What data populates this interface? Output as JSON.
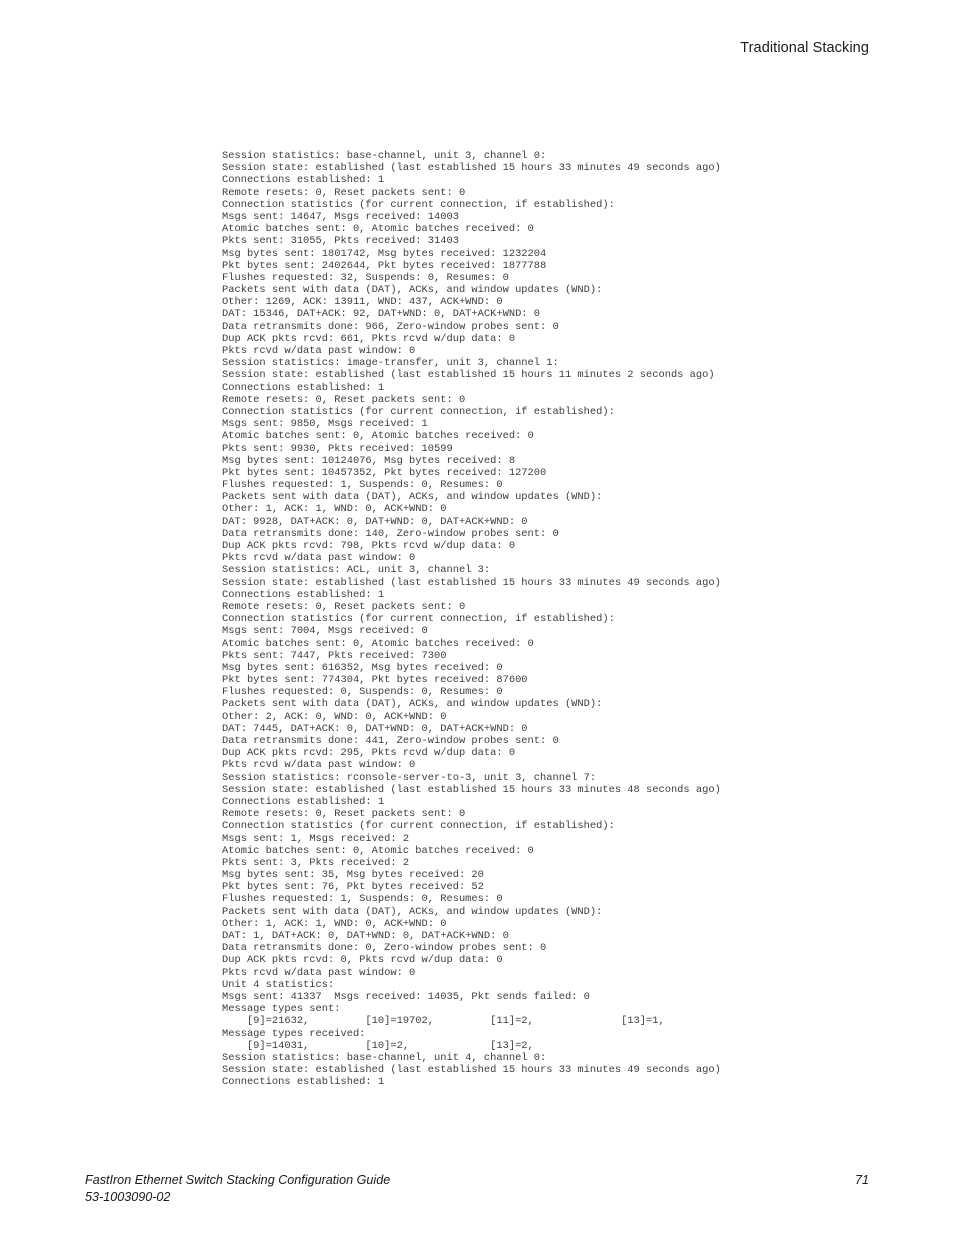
{
  "header": {
    "running_head": "Traditional Stacking"
  },
  "console_output": {
    "lines": [
      "Session statistics: base-channel, unit 3, channel 0:",
      "Session state: established (last established 15 hours 33 minutes 49 seconds ago)",
      "Connections established: 1",
      "Remote resets: 0, Reset packets sent: 0",
      "Connection statistics (for current connection, if established):",
      "Msgs sent: 14647, Msgs received: 14003",
      "Atomic batches sent: 0, Atomic batches received: 0",
      "Pkts sent: 31055, Pkts received: 31403",
      "Msg bytes sent: 1801742, Msg bytes received: 1232204",
      "Pkt bytes sent: 2402644, Pkt bytes received: 1877788",
      "Flushes requested: 32, Suspends: 0, Resumes: 0",
      "Packets sent with data (DAT), ACKs, and window updates (WND):",
      "Other: 1269, ACK: 13911, WND: 437, ACK+WND: 0",
      "DAT: 15346, DAT+ACK: 92, DAT+WND: 0, DAT+ACK+WND: 0",
      "Data retransmits done: 966, Zero-window probes sent: 0",
      "Dup ACK pkts rcvd: 661, Pkts rcvd w/dup data: 0",
      "Pkts rcvd w/data past window: 0",
      "Session statistics: image-transfer, unit 3, channel 1:",
      "Session state: established (last established 15 hours 11 minutes 2 seconds ago)",
      "Connections established: 1",
      "Remote resets: 0, Reset packets sent: 0",
      "Connection statistics (for current connection, if established):",
      "Msgs sent: 9850, Msgs received: 1",
      "Atomic batches sent: 0, Atomic batches received: 0",
      "Pkts sent: 9930, Pkts received: 10599",
      "Msg bytes sent: 10124076, Msg bytes received: 8",
      "Pkt bytes sent: 10457352, Pkt bytes received: 127200",
      "Flushes requested: 1, Suspends: 0, Resumes: 0",
      "Packets sent with data (DAT), ACKs, and window updates (WND):",
      "Other: 1, ACK: 1, WND: 0, ACK+WND: 0",
      "DAT: 9928, DAT+ACK: 0, DAT+WND: 0, DAT+ACK+WND: 0",
      "Data retransmits done: 140, Zero-window probes sent: 0",
      "Dup ACK pkts rcvd: 798, Pkts rcvd w/dup data: 0",
      "Pkts rcvd w/data past window: 0",
      "Session statistics: ACL, unit 3, channel 3:",
      "Session state: established (last established 15 hours 33 minutes 49 seconds ago)",
      "Connections established: 1",
      "Remote resets: 0, Reset packets sent: 0",
      "Connection statistics (for current connection, if established):",
      "Msgs sent: 7004, Msgs received: 0",
      "Atomic batches sent: 0, Atomic batches received: 0",
      "Pkts sent: 7447, Pkts received: 7300",
      "Msg bytes sent: 616352, Msg bytes received: 0",
      "Pkt bytes sent: 774304, Pkt bytes received: 87600",
      "Flushes requested: 0, Suspends: 0, Resumes: 0",
      "Packets sent with data (DAT), ACKs, and window updates (WND):",
      "Other: 2, ACK: 0, WND: 0, ACK+WND: 0",
      "DAT: 7445, DAT+ACK: 0, DAT+WND: 0, DAT+ACK+WND: 0",
      "Data retransmits done: 441, Zero-window probes sent: 0",
      "Dup ACK pkts rcvd: 295, Pkts rcvd w/dup data: 0",
      "Pkts rcvd w/data past window: 0",
      "Session statistics: rconsole-server-to-3, unit 3, channel 7:",
      "Session state: established (last established 15 hours 33 minutes 48 seconds ago)",
      "Connections established: 1",
      "Remote resets: 0, Reset packets sent: 0",
      "Connection statistics (for current connection, if established):",
      "Msgs sent: 1, Msgs received: 2",
      "Atomic batches sent: 0, Atomic batches received: 0",
      "Pkts sent: 3, Pkts received: 2",
      "Msg bytes sent: 35, Msg bytes received: 20",
      "Pkt bytes sent: 76, Pkt bytes received: 52",
      "Flushes requested: 1, Suspends: 0, Resumes: 0",
      "Packets sent with data (DAT), ACKs, and window updates (WND):",
      "Other: 1, ACK: 1, WND: 0, ACK+WND: 0",
      "DAT: 1, DAT+ACK: 0, DAT+WND: 0, DAT+ACK+WND: 0",
      "Data retransmits done: 0, Zero-window probes sent: 0",
      "Dup ACK pkts rcvd: 0, Pkts rcvd w/dup data: 0",
      "Pkts rcvd w/data past window: 0",
      "Unit 4 statistics:",
      "Msgs sent: 41337  Msgs received: 14035, Pkt sends failed: 0",
      "Message types sent:",
      "    [9]=21632,         [10]=19702,         [11]=2,              [13]=1,",
      "Message types received:",
      "    [9]=14031,         [10]=2,             [13]=2,",
      "Session statistics: base-channel, unit 4, channel 0:",
      "Session state: established (last established 15 hours 33 minutes 49 seconds ago)",
      "Connections established: 1"
    ]
  },
  "footer": {
    "title": "FastIron Ethernet Switch Stacking Configuration Guide",
    "doc_number": "53-1003090-02",
    "page_number": "71"
  }
}
